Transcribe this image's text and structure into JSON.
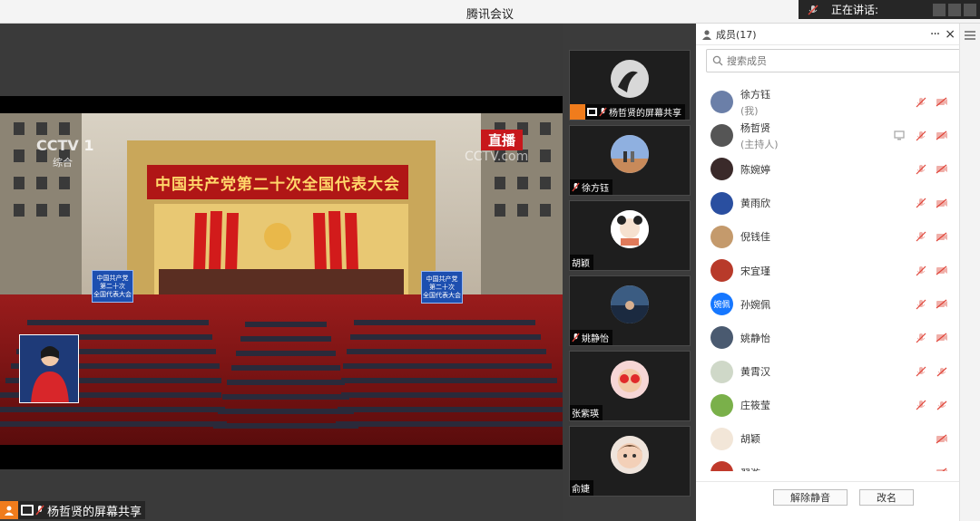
{
  "window": {
    "title": "腾讯会议"
  },
  "speaking": {
    "label": "正在讲话:",
    "name": ""
  },
  "stage": {
    "banner": "中国共产党第二十次全国代表大会",
    "cctv": "CCTV 1",
    "cctv_sub": "综合",
    "live": "直播",
    "watermark": "CCTV.com",
    "sign_left": [
      "中国共产党",
      "第二十次",
      "全国代表大会"
    ],
    "sign_right": [
      "中国共产党",
      "第二十次",
      "全国代表大会"
    ]
  },
  "share_bar": {
    "label": "杨哲贤的屏幕共享"
  },
  "tiles": [
    {
      "label": "杨哲贤的屏幕共享",
      "kind": "share"
    },
    {
      "label": "徐方钰",
      "kind": "muted"
    },
    {
      "label": "胡颖",
      "kind": "plain"
    },
    {
      "label": "姚静怡",
      "kind": "muted"
    },
    {
      "label": "张紫瑛",
      "kind": "plain"
    },
    {
      "label": "俞婕",
      "kind": "plain"
    }
  ],
  "panel": {
    "title": "成员(17)",
    "more": "···",
    "close": "×",
    "search_placeholder": "搜索成员",
    "unmute_label": "解除静音",
    "rename_label": "改名"
  },
  "members": [
    {
      "name": "徐方钰",
      "sub": "(我)",
      "avatar_color": "#6b7fa8",
      "avatar_text": "",
      "share": false,
      "mic": true,
      "cam": true
    },
    {
      "name": "杨哲贤",
      "sub": "(主持人)",
      "avatar_color": "#555555",
      "avatar_text": "",
      "share": true,
      "mic": true,
      "cam": true
    },
    {
      "name": "陈婉婷",
      "sub": "",
      "avatar_color": "#3a2a2a",
      "avatar_text": "",
      "share": false,
      "mic": true,
      "cam": true
    },
    {
      "name": "黄雨欣",
      "sub": "",
      "avatar_color": "#2a4fa0",
      "avatar_text": "",
      "share": false,
      "mic": true,
      "cam": true
    },
    {
      "name": "倪钱佳",
      "sub": "",
      "avatar_color": "#c49a6c",
      "avatar_text": "",
      "share": false,
      "mic": true,
      "cam": true
    },
    {
      "name": "宋宜瑾",
      "sub": "",
      "avatar_color": "#b83a2a",
      "avatar_text": "",
      "share": false,
      "mic": true,
      "cam": true
    },
    {
      "name": "孙婉佩",
      "sub": "",
      "avatar_color": "#1677ff",
      "avatar_text": "婉佩",
      "share": false,
      "mic": true,
      "cam": true
    },
    {
      "name": "姚静怡",
      "sub": "",
      "avatar_color": "#4a5a70",
      "avatar_text": "",
      "share": false,
      "mic": true,
      "cam": true
    },
    {
      "name": "黄霄汉",
      "sub": "",
      "avatar_color": "#cfd8c8",
      "avatar_text": "",
      "share": false,
      "mic": true,
      "cam": false
    },
    {
      "name": "庄筱莹",
      "sub": "",
      "avatar_color": "#7ab04a",
      "avatar_text": "",
      "share": false,
      "mic": true,
      "cam": false
    },
    {
      "name": "胡颖",
      "sub": "",
      "avatar_color": "#f2e6d8",
      "avatar_text": "",
      "share": false,
      "mic": false,
      "cam": true
    },
    {
      "name": "翟漩",
      "sub": "",
      "avatar_color": "#c0392b",
      "avatar_text": "",
      "share": false,
      "mic": false,
      "cam": true
    }
  ],
  "colors": {
    "accent": "#f07c1c",
    "muted_red": "#e0453a",
    "scroll": "#21c35a"
  }
}
